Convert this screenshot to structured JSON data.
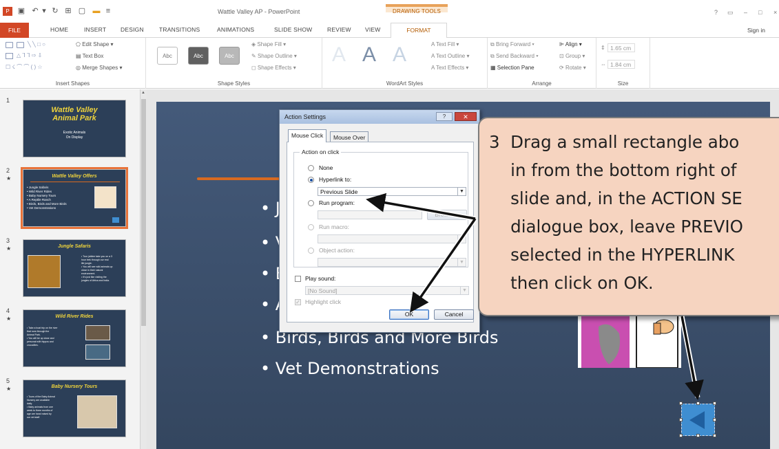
{
  "window": {
    "title": "Wattle Valley AP - PowerPoint",
    "context_tab_group": "DRAWING TOOLS",
    "window_controls": [
      "?",
      "▭",
      "–",
      "□",
      "×"
    ]
  },
  "ribbon_tabs": {
    "file": "FILE",
    "items": [
      "HOME",
      "INSERT",
      "DESIGN",
      "TRANSITIONS",
      "ANIMATIONS",
      "SLIDE SHOW",
      "REVIEW",
      "VIEW"
    ],
    "active": "FORMAT",
    "sign_in": "Sign in"
  },
  "ribbon": {
    "insert_shapes": {
      "label": "Insert Shapes",
      "edit_shape": "Edit Shape",
      "text_box": "Text Box",
      "merge_shapes": "Merge Shapes"
    },
    "shape_styles": {
      "label": "Shape Styles",
      "style_boxes": [
        "Abc",
        "Abc",
        "Abc"
      ],
      "fill": "Shape Fill",
      "outline": "Shape Outline",
      "effects": "Shape Effects"
    },
    "wordart_styles": {
      "label": "WordArt Styles",
      "letters": [
        "A",
        "A",
        "A"
      ],
      "text_fill": "Text Fill",
      "text_outline": "Text Outline",
      "text_effects": "Text Effects"
    },
    "arrange": {
      "label": "Arrange",
      "bring_forward": "Bring Forward",
      "send_backward": "Send Backward",
      "selection_pane": "Selection Pane",
      "align": "Align",
      "group": "Group",
      "rotate": "Rotate"
    },
    "size": {
      "label": "Size",
      "height": "1.65 cm",
      "width": "1.84 cm"
    }
  },
  "slides_panel": [
    {
      "num": "1",
      "title": "Wattle Valley Animal Park",
      "title_lines": [
        "Wattle Valley",
        "Animal Park"
      ],
      "sub_lines": [
        "Exotic Animals",
        "On Display"
      ],
      "star": ""
    },
    {
      "num": "2",
      "title": "Wattle Valley Offers",
      "lines": [
        "• Jungle Safaris",
        "• Wild River Rides",
        "• Baby Nursery Tours",
        "• A Reptile Ranch",
        "• Birds, Birds and More Birds",
        "• Vet Demonstrations"
      ],
      "star": "★",
      "selected": true
    },
    {
      "num": "3",
      "title": "Jungle Safaris",
      "lines": [
        "• Tour jubilee take you on a 3",
        "  hour trek through our real",
        "  life jungle.",
        "• You will see wild animals up",
        "  close in their natural",
        "  environment.",
        "• It's just like visiting the",
        "  jungles of Africa and India."
      ],
      "star": "★"
    },
    {
      "num": "4",
      "title": "Wild River Rides",
      "lines": [
        "• Take a boat trip on the river",
        "  that runs through the",
        "  Animal Park.",
        "• You will be up close and",
        "  personal with hippos and",
        "  crocodiles."
      ],
      "star": "★"
    },
    {
      "num": "5",
      "title": "Baby Nursery Tours",
      "lines": [
        "• Tours of the Baby Animal",
        "  Nursery are available",
        "  daily.",
        "• Baby animals from one",
        "  week to three months of",
        "  age are hand raised by",
        "  our vet staff."
      ],
      "star": "★"
    }
  ],
  "slide": {
    "bullets": [
      "• J",
      "• V",
      "• B",
      "• A",
      "• Birds, Birds and More Birds",
      "• Vet Demonstrations"
    ]
  },
  "dialog": {
    "title": "Action Settings",
    "tabs": [
      "Mouse Click",
      "Mouse Over"
    ],
    "group_label": "Action on click",
    "options": {
      "none": "None",
      "hyperlink": "Hyperlink to:",
      "hyperlink_value": "Previous Slide",
      "run_program": "Run program:",
      "browse": "Browse...",
      "run_macro": "Run macro:",
      "object_action": "Object action:"
    },
    "play_sound": "Play sound:",
    "sound_value": "[No Sound]",
    "highlight_click": "Highlight click",
    "ok": "OK",
    "cancel": "Cancel"
  },
  "callout": {
    "text": "3  Drag a small rectangle abo\n    in from the bottom right of\n    slide and, in the ACTION SE\n    dialogue box, leave PREVIO\n    selected in the HYPERLINK \n    then click on OK."
  },
  "colors": {
    "file_tab": "#d24726",
    "format_tab": "#b35a00",
    "slide_bg": "#3a5070",
    "callout_bg": "#f6d4c0",
    "thumb_title": "#f0d43c",
    "action_button": "#3f8ed1"
  }
}
